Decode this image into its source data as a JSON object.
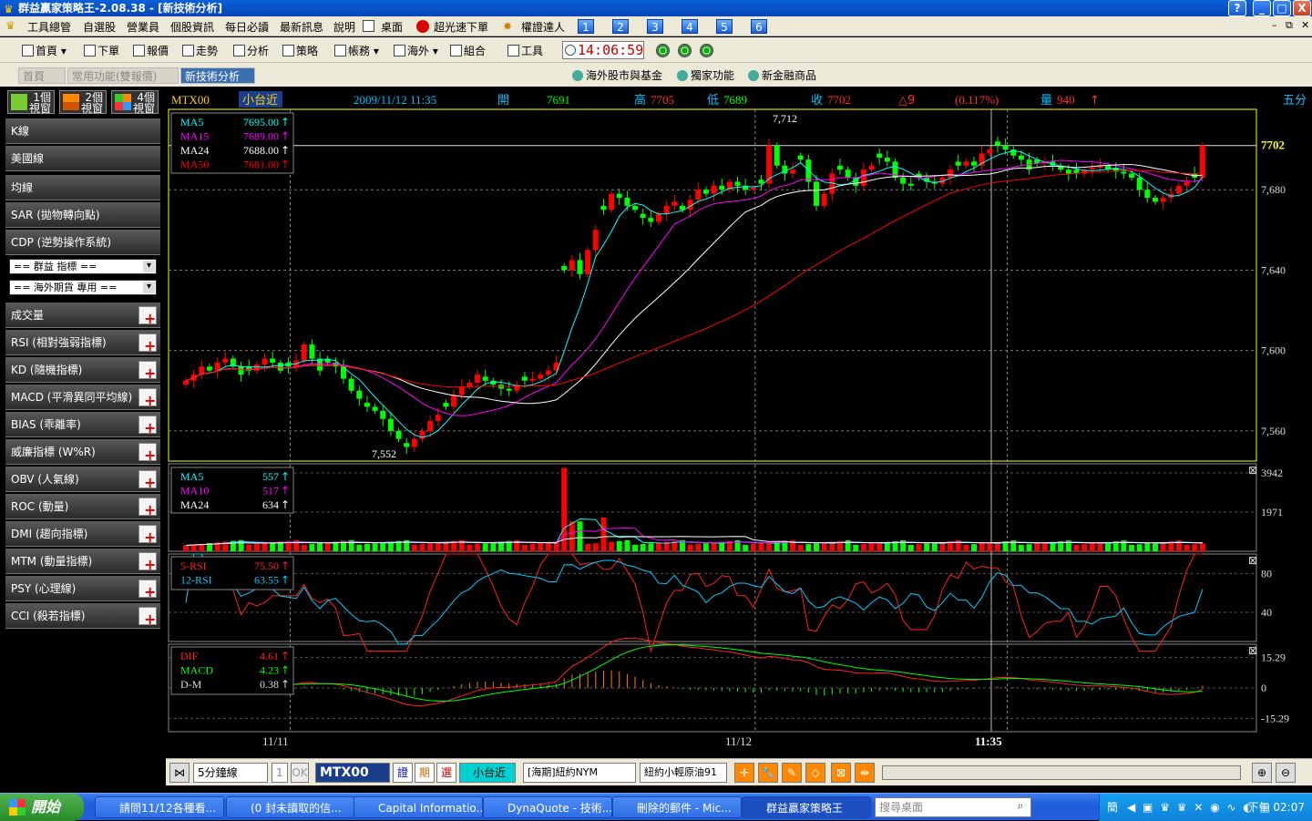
{
  "window": {
    "title": "群益贏家策略王-2.08.38 - [新技術分析]",
    "controls": [
      "?",
      "_",
      "□",
      "X"
    ]
  },
  "menu": [
    "工具總管",
    "自選股",
    "營業員",
    "個股資訊",
    "每日必讀",
    "最新訊息",
    "說明",
    "桌面",
    "超光速下單",
    "權證達人"
  ],
  "menu_numbers": [
    "1",
    "2",
    "3",
    "4",
    "5",
    "6"
  ],
  "toolbar": {
    "items": [
      "首頁",
      "下單",
      "報價",
      "走勢",
      "分析",
      "策略",
      "帳務",
      "海外",
      "組合",
      "工具"
    ],
    "clock": "14:06:59"
  },
  "tabs": [
    "首頁",
    "常用功能(雙報價)",
    "新技術分析"
  ],
  "quicklinks": [
    "海外股市與基金",
    "獨家功能",
    "新金融商品"
  ],
  "sidebar": {
    "window_buttons": [
      {
        "num": "1個",
        "label": "視窗"
      },
      {
        "num": "2個",
        "label": "視窗"
      },
      {
        "num": "4個",
        "label": "視窗"
      }
    ],
    "main_items": [
      "K線",
      "美國線",
      "均線",
      "SAR (拋物轉向點)",
      "CDP (逆勢操作系統)"
    ],
    "selects": [
      "== 群益 指標 ==",
      "== 海外期貨 專用 =="
    ],
    "indicators": [
      "成交量",
      "RSI (相對強弱指標)",
      "KD (隨機指標)",
      "MACD (平滑異同平均線)",
      "BIAS (乖離率)",
      "威廉指標 (W%R)",
      "OBV (人氣線)",
      "ROC (動量)",
      "DMI (趨向指標)",
      "MTM (動量指標)",
      "PSY (心理線)",
      "CCI (殺若指標)"
    ]
  },
  "header": {
    "symbol": "MTX00",
    "name": "小台近",
    "datetime": "2009/11/12 11:35",
    "open_label": "開",
    "open": "7691",
    "high_label": "高",
    "high": "7705",
    "low_label": "低",
    "low": "7689",
    "close_label": "收",
    "close": "7702",
    "change": "△9",
    "change_pct": "(0.117%)",
    "volume_label": "量",
    "volume": "940",
    "period": "五分"
  },
  "colors": {
    "up": "#ff0000",
    "down": "#00ff00",
    "ma5": "#00ffff",
    "ma15": "#ff00ff",
    "ma24": "#ffffff",
    "ma50": "#ff0000",
    "axis": "#ffffff",
    "frame": "#ffff00"
  },
  "chart_data": [
    {
      "type": "candlestick",
      "name": "price",
      "y_ticks": [
        7560,
        7600,
        7640,
        7680
      ],
      "last_price": "7702",
      "ylim": [
        7545,
        7720
      ],
      "high_label": "7,712",
      "low_label": "7,552",
      "x_labels": [
        "11/11",
        "11/12",
        "11:35"
      ],
      "legend": [
        {
          "name": "MA5",
          "value": "7695.00"
        },
        {
          "name": "MA15",
          "value": "7689.00"
        },
        {
          "name": "MA24",
          "value": "7688.00"
        },
        {
          "name": "MA50",
          "value": "7681.00"
        }
      ],
      "closes": [
        7585,
        7588,
        7592,
        7590,
        7594,
        7596,
        7592,
        7588,
        7590,
        7593,
        7596,
        7594,
        7590,
        7592,
        7595,
        7603,
        7596,
        7590,
        7594,
        7592,
        7586,
        7580,
        7576,
        7572,
        7570,
        7566,
        7560,
        7556,
        7552,
        7556,
        7560,
        7565,
        7568,
        7572,
        7578,
        7582,
        7584,
        7588,
        7585,
        7583,
        7581,
        7580,
        7583,
        7585,
        7586,
        7588,
        7590,
        7594,
        7640,
        7645,
        7638,
        7650,
        7660,
        7670,
        7678,
        7676,
        7672,
        7670,
        7666,
        7664,
        7668,
        7672,
        7674,
        7670,
        7675,
        7680,
        7678,
        7682,
        7680,
        7684,
        7682,
        7680,
        7681,
        7683,
        7702,
        7692,
        7688,
        7690,
        7695,
        7684,
        7672,
        7678,
        7688,
        7690,
        7686,
        7682,
        7690,
        7692,
        7696,
        7694,
        7686,
        7683,
        7682,
        7686,
        7684,
        7683,
        7686,
        7690,
        7692,
        7694,
        7692,
        7698,
        7700,
        7702,
        7700,
        7697,
        7695,
        7690,
        7693,
        7694,
        7692,
        7690,
        7688,
        7688,
        7690,
        7691,
        7692,
        7690,
        7689,
        7688,
        7686,
        7680,
        7676,
        7674,
        7676,
        7678,
        7682,
        7684,
        7686,
        7702
      ]
    },
    {
      "type": "bar",
      "name": "volume",
      "y_ticks": [
        1971,
        3942
      ],
      "ylim": [
        0,
        4400
      ],
      "legend": [
        {
          "name": "MA5",
          "value": "557"
        },
        {
          "name": "MA10",
          "value": "517"
        },
        {
          "name": "MA24",
          "value": "634"
        }
      ]
    },
    {
      "type": "line",
      "name": "RSI",
      "y_ticks": [
        40,
        80
      ],
      "ylim": [
        10,
        100
      ],
      "legend": [
        {
          "name": "5-RSI",
          "value": "75.50"
        },
        {
          "name": "12-RSI",
          "value": "63.55"
        }
      ]
    },
    {
      "type": "line",
      "name": "MACD",
      "y_ticks": [
        "15.29",
        "0",
        "-15.29"
      ],
      "ylim": [
        -22,
        22
      ],
      "legend": [
        {
          "name": "DIF",
          "value": "4.61"
        },
        {
          "name": "MACD",
          "value": "4.23"
        },
        {
          "name": "D-M",
          "value": "0.38"
        }
      ]
    }
  ],
  "bottom": {
    "interval": "5分鐘線",
    "count": "1",
    "ok": "OK",
    "symbol": "MTX00",
    "btn_a": "證",
    "btn_b": "期",
    "btn_c": "選",
    "name": "小台近",
    "market": "[海期]紐約NYM",
    "product": "紐約小輕原油91"
  },
  "taskbar": {
    "start": "開始",
    "tasks": [
      "請問11/12各種看...",
      "(0 封未讀取的信...",
      "Capital Informatio...",
      "DynaQuote - 技術...",
      "刪除的郵件 - Mic...",
      "群益贏家策略王"
    ],
    "search_placeholder": "搜尋桌面",
    "clock": "下午 02:07"
  }
}
